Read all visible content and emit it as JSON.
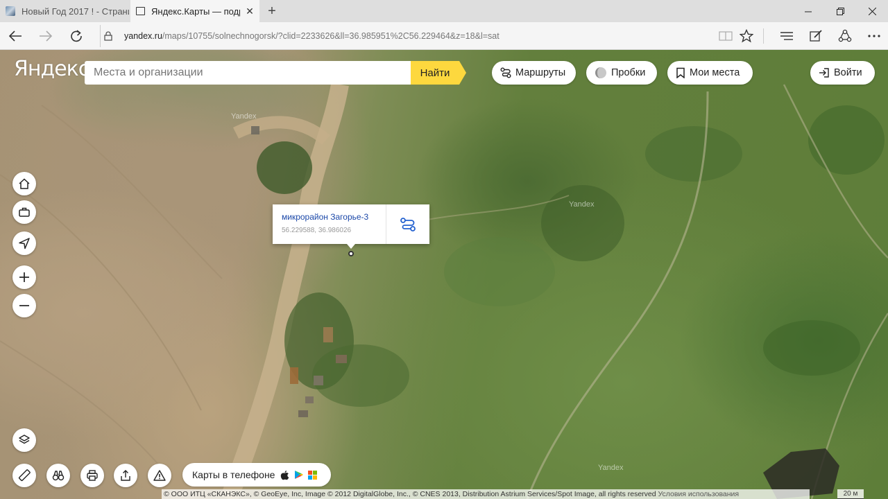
{
  "browser": {
    "tabs": [
      {
        "title": "Новый Год 2017 ! - Страни",
        "active": false
      },
      {
        "title": "Яндекс.Карты — подро",
        "active": true
      }
    ],
    "url_domain": "yandex.ru",
    "url_path": "/maps/10755/solnechnogorsk/?clid=2233626&ll=36.985951%2C56.229464&z=18&l=sat"
  },
  "header": {
    "logo": "Яндекс",
    "search_placeholder": "Места и организации",
    "search_button": "Найти",
    "routes": "Маршруты",
    "traffic": "Пробки",
    "my_places": "Мои места",
    "login": "Войти"
  },
  "popup": {
    "name": "микрорайон Загорье-3",
    "coords": "56.229588, 36.986026"
  },
  "watermarks": [
    "Yandex",
    "Yandex",
    "Yandex"
  ],
  "phone_promo": "Карты в телефоне",
  "copyright": "© ООО ИТЦ «СКАНЭКС», © GeoEye, Inc, Image © 2012 DigitalGlobe, Inc., © CNES 2013, Distribution Astrium Services/Spot Image, all rights reserved",
  "terms": "Условия использования",
  "scale": "20 м"
}
